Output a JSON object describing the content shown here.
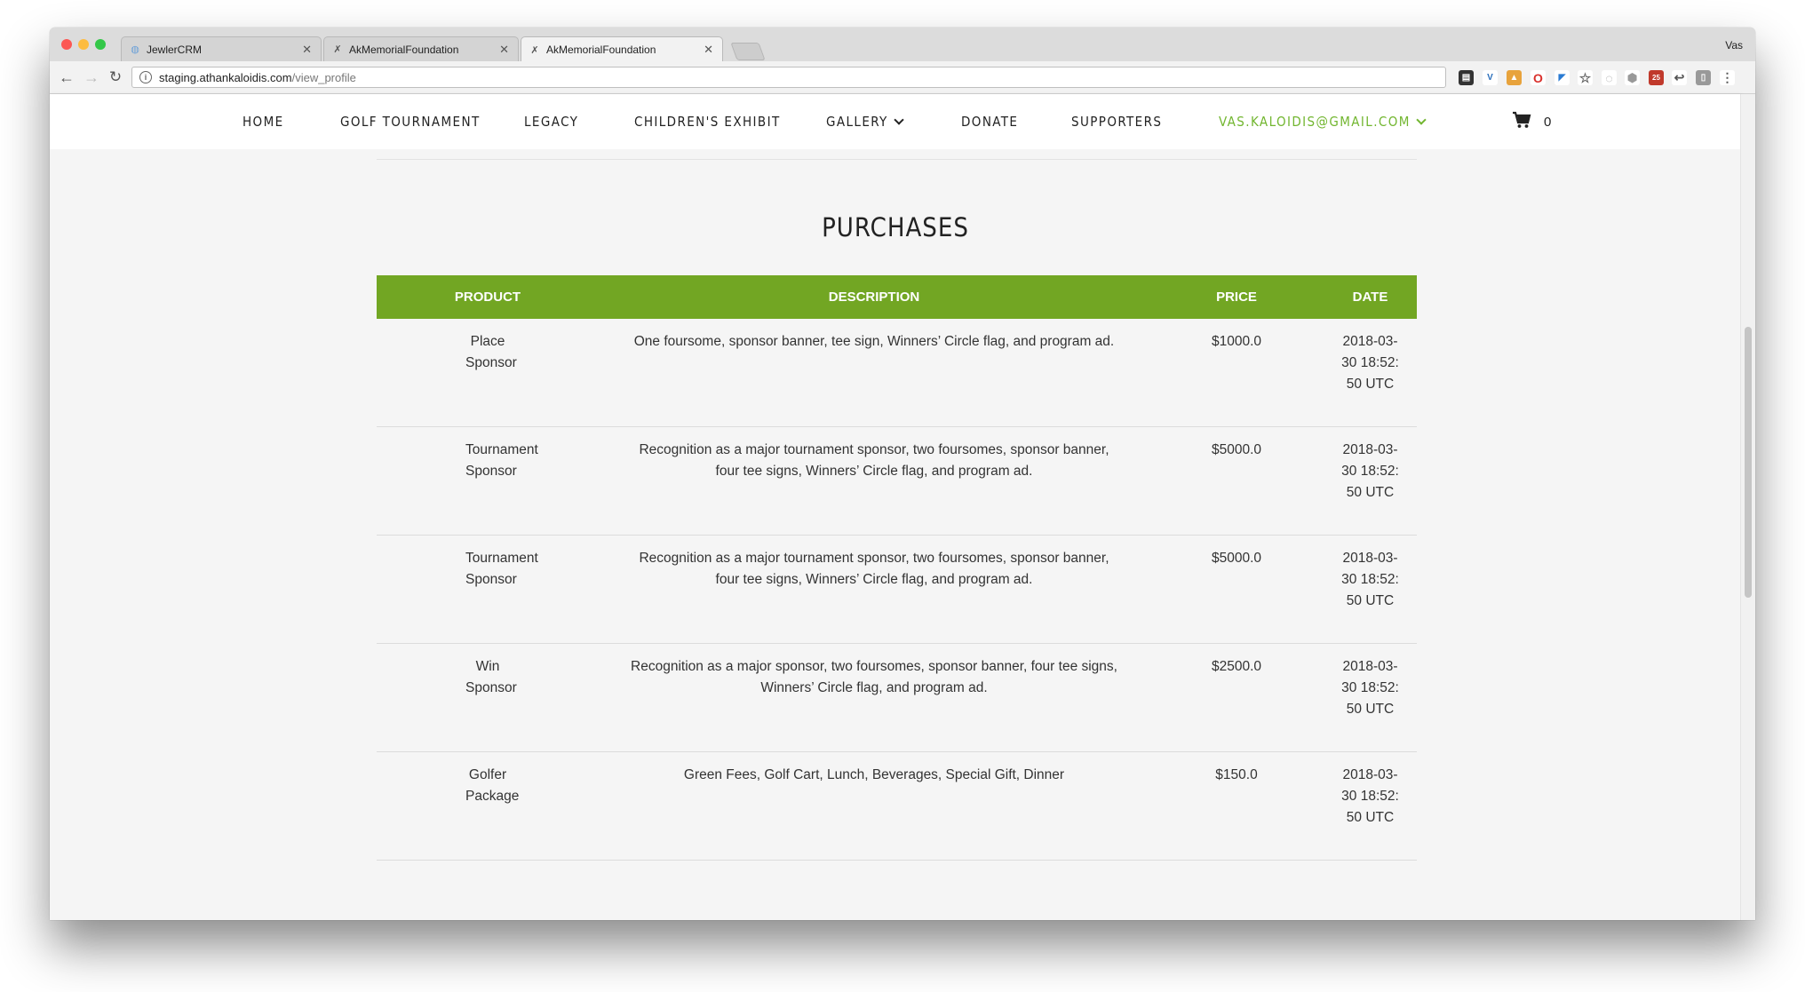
{
  "browser": {
    "tabs": [
      {
        "title": "JewlerCRM",
        "active": false
      },
      {
        "title": "AkMemorialFoundation",
        "active": false
      },
      {
        "title": "AkMemorialFoundation",
        "active": true
      }
    ],
    "profile_name": "Vas",
    "url_host": "staging.athankaloidis.com",
    "url_path": "/view_profile",
    "calendar_badge": "25"
  },
  "nav": {
    "items": [
      "HOME",
      "GOLF TOURNAMENT",
      "LEGACY",
      "CHILDREN'S EXHIBIT",
      "GALLERY",
      "DONATE",
      "SUPPORTERS"
    ],
    "account_email": "VAS.KALOIDIS@GMAIL.COM",
    "cart_count": "0"
  },
  "purchases": {
    "title": "PURCHASES",
    "columns": {
      "product": "PRODUCT",
      "description": "DESCRIPTION",
      "price": "PRICE",
      "date": "DATE"
    },
    "rows": [
      {
        "product": "Place Sponsor",
        "description": "One foursome, sponsor banner, tee sign, Winners’ Circle flag, and program ad.",
        "price": "$1000.0",
        "date": "2018-03-30 18:52:50 UTC"
      },
      {
        "product": "Tournament Sponsor",
        "description": "Recognition as a major tournament sponsor, two foursomes, sponsor banner, four tee signs, Winners’ Circle flag, and program ad.",
        "price": "$5000.0",
        "date": "2018-03-30 18:52:50 UTC"
      },
      {
        "product": "Tournament Sponsor",
        "description": "Recognition as a major tournament sponsor, two foursomes, sponsor banner, four tee signs, Winners’ Circle flag, and program ad.",
        "price": "$5000.0",
        "date": "2018-03-30 18:52:50 UTC"
      },
      {
        "product": "Win Sponsor",
        "description": "Recognition as a major sponsor, two foursomes, sponsor banner, four tee signs, Winners’ Circle flag, and program ad.",
        "price": "$2500.0",
        "date": "2018-03-30 18:52:50 UTC"
      },
      {
        "product": "Golfer Package",
        "description": "Green Fees, Golf Cart, Lunch, Beverages, Special Gift, Dinner",
        "price": "$150.0",
        "date": "2018-03-30 18:52:50 UTC"
      }
    ]
  },
  "colors": {
    "brand_green": "#72a623",
    "link_green": "#72b630",
    "back_to_top": "#8dc63f"
  }
}
